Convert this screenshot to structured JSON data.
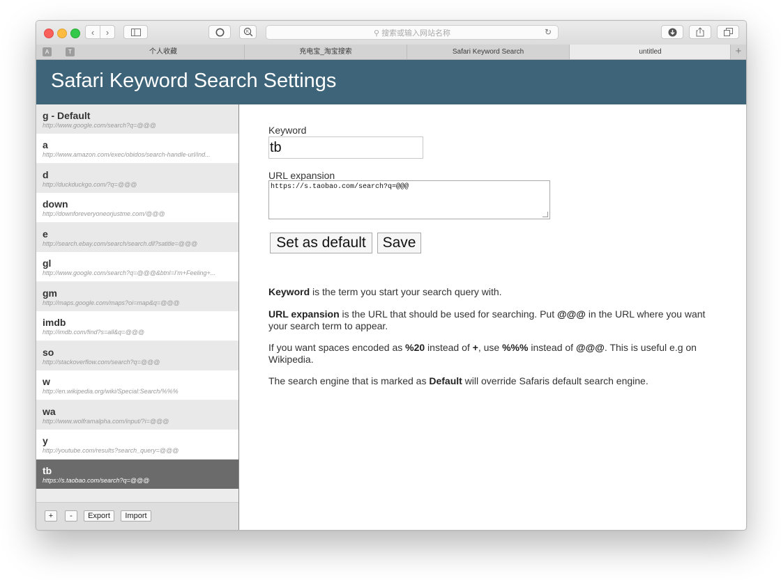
{
  "browser": {
    "address_placeholder": "搜索或输入网站名称",
    "tabs": [
      {
        "label": "个人收藏"
      },
      {
        "label": "充电宝_淘宝搜索"
      },
      {
        "label": "Safari Keyword Search"
      },
      {
        "label": "untitled"
      }
    ],
    "favicons": [
      "A",
      "T"
    ],
    "new_tab_label": "+"
  },
  "header": {
    "title": "Safari Keyword Search Settings"
  },
  "sidebar": {
    "items": [
      {
        "keyword": "g - Default",
        "url": "http://www.google.com/search?q=@@@"
      },
      {
        "keyword": "a",
        "url": "http://www.amazon.com/exec/obidos/search-handle-url/ind..."
      },
      {
        "keyword": "d",
        "url": "http://duckduckgo.com/?q=@@@"
      },
      {
        "keyword": "down",
        "url": "http://downforeveryoneorjustme.com/@@@"
      },
      {
        "keyword": "e",
        "url": "http://search.ebay.com/search/search.dll?satitle=@@@"
      },
      {
        "keyword": "gl",
        "url": "http://www.google.com/search?q=@@@&btnI=I'm+Feeling+..."
      },
      {
        "keyword": "gm",
        "url": "http://maps.google.com/maps?oi=map&q=@@@"
      },
      {
        "keyword": "imdb",
        "url": "http://imdb.com/find?s=all&q=@@@"
      },
      {
        "keyword": "so",
        "url": "http://stackoverflow.com/search?q=@@@"
      },
      {
        "keyword": "w",
        "url": "http://en.wikipedia.org/wiki/Special:Search/%%%"
      },
      {
        "keyword": "wa",
        "url": "http://www.wolframalpha.com/input/?i=@@@"
      },
      {
        "keyword": "y",
        "url": "http://youtube.com/results?search_query=@@@"
      },
      {
        "keyword": "tb",
        "url": "https://s.taobao.com/search?q=@@@"
      }
    ],
    "footer": {
      "add": "+",
      "remove": "-",
      "export": "Export",
      "import": "Import"
    }
  },
  "form": {
    "keyword_label": "Keyword",
    "keyword_value": "tb",
    "url_label": "URL expansion",
    "url_value": "https://s.taobao.com/search?q=@@@",
    "set_default_label": "Set as default",
    "save_label": "Save"
  },
  "help": {
    "p1": {
      "b": "Keyword",
      "t": " is the term you start your search query with."
    },
    "p2": {
      "b1": "URL expansion",
      "t1": " is the URL that should be used for searching. Put ",
      "b2": "@@@",
      "t2": " in the URL where you want your search term to appear."
    },
    "p3": {
      "t1": "If you want spaces encoded as ",
      "b1": "%20",
      "t2": " instead of ",
      "b2": "+",
      "t3": ", use ",
      "b3": "%%%",
      "t4": " instead of ",
      "b4": "@@@",
      "t5": ". This is useful e.g on Wikipedia."
    },
    "p4": {
      "t1": "The search engine that is marked as ",
      "b": "Default",
      "t2": " will override Safaris default search engine."
    }
  },
  "colors": {
    "header_bg": "#3d6478",
    "selected_item_bg": "#6b6b6b"
  }
}
